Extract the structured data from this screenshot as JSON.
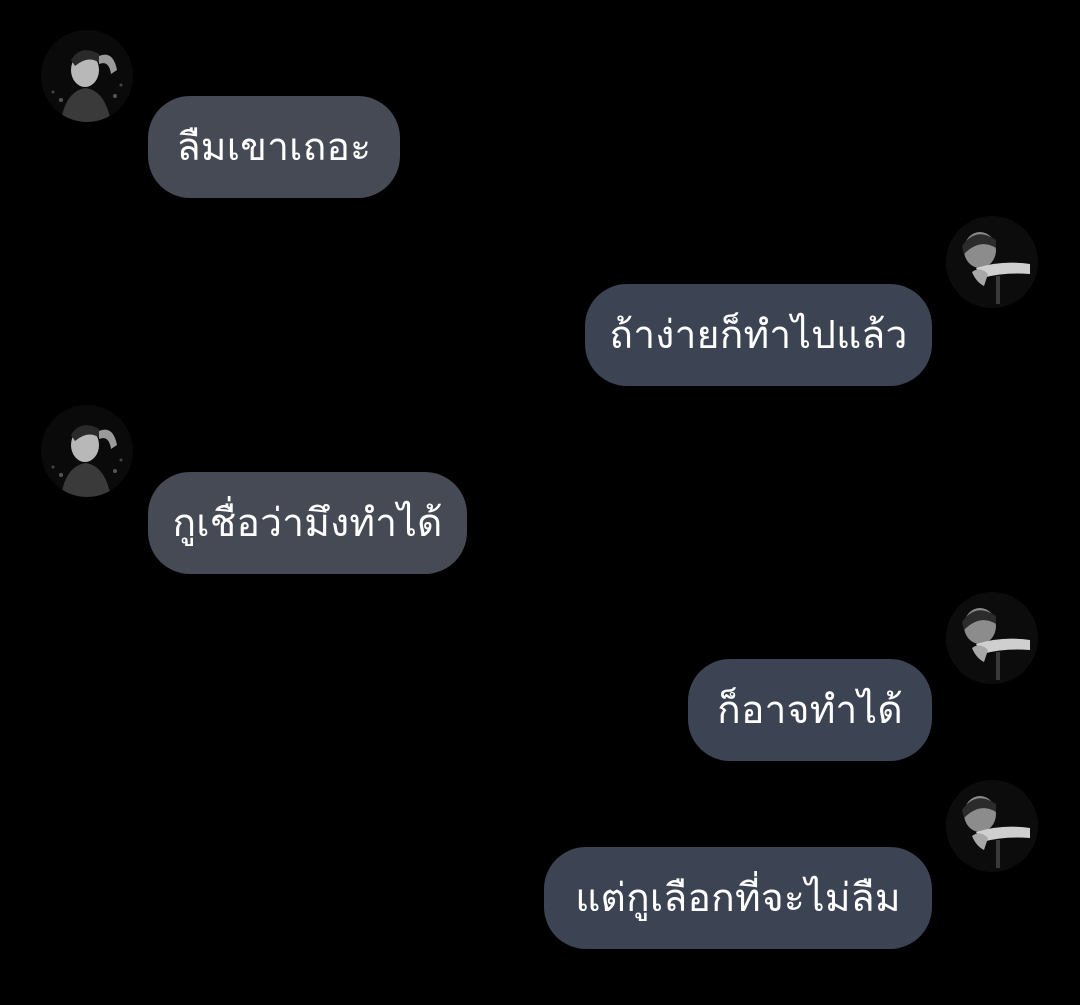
{
  "conversation": {
    "messages": [
      {
        "sender": "other",
        "text": "ลืมเขาเถอะ",
        "avatar_icon": "profile-avatar-icon"
      },
      {
        "sender": "me",
        "text": "ถ้าง่ายก็ทำไปแล้ว",
        "avatar_icon": "profile-avatar-icon"
      },
      {
        "sender": "other",
        "text": "กูเชื่อว่ามึงทำได้",
        "avatar_icon": "profile-avatar-icon"
      },
      {
        "sender": "me",
        "text": "ก็อาจทำได้",
        "avatar_icon": "profile-avatar-icon"
      },
      {
        "sender": "me",
        "text": "แต่กูเลือกที่จะไม่ลืม",
        "avatar_icon": "profile-avatar-icon"
      }
    ]
  },
  "colors": {
    "background": "#000000",
    "bubble_other": "#464a54",
    "bubble_me": "#3c4454",
    "text": "#ffffff"
  }
}
